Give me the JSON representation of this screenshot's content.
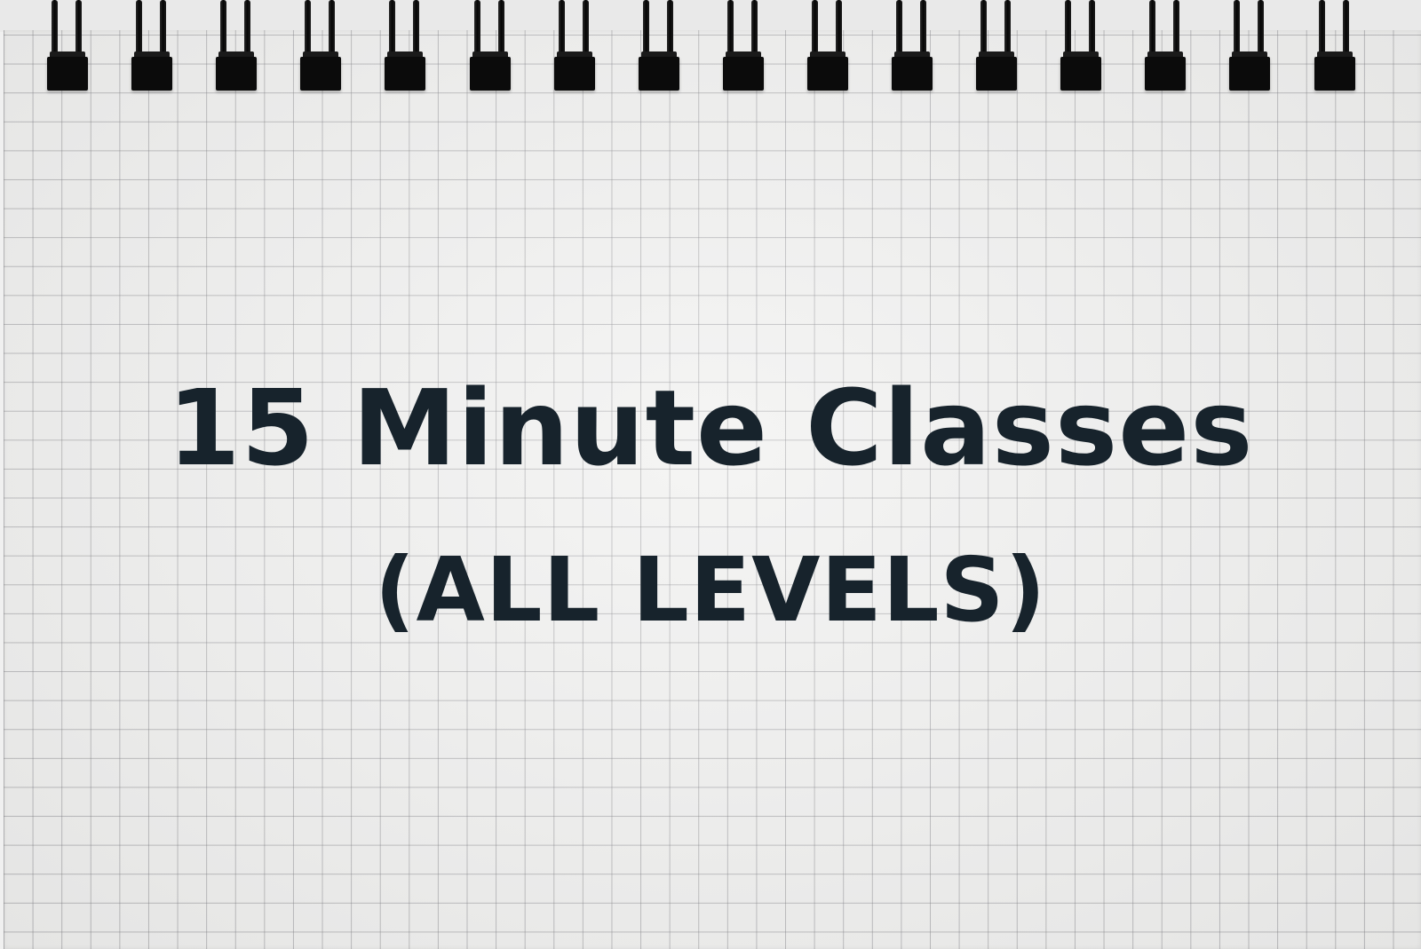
{
  "title": "15 Minute Classes",
  "subtitle": "(ALL LEVELS)",
  "colors": {
    "text": "#17232c",
    "paper": "#f1f1f0",
    "grid_lines": "#8a8a90",
    "binding": "#0b0b0b"
  },
  "background": "graph-paper notebook with spiral binding"
}
